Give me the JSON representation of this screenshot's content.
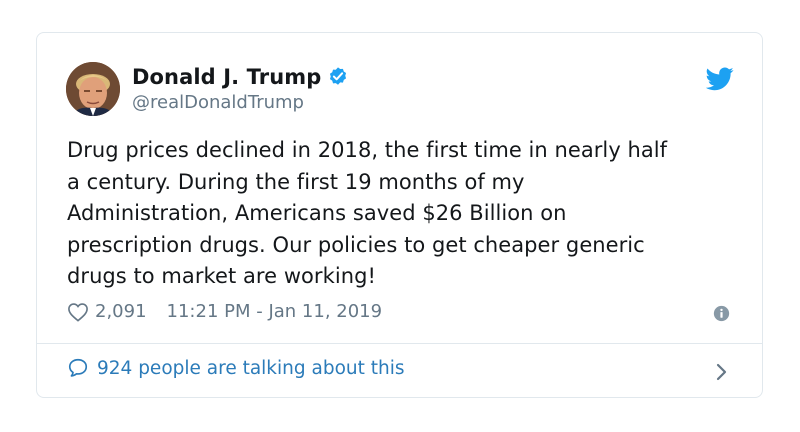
{
  "tweet": {
    "author": {
      "display_name": "Donald J. Trump",
      "handle": "@realDonaldTrump",
      "verified": true
    },
    "text": "Drug prices declined in 2018, the first time in nearly half\na century. During the first 19 months of my\nAdministration, Americans saved $26 Billion on\nprescription drugs. Our policies to get cheaper generic\ndrugs to market are working!",
    "likes": "2,091",
    "timestamp": "11:21 PM - Jan 11, 2019",
    "conversation": "924 people are talking about this"
  },
  "icons": {
    "brand": "twitter-bird-icon",
    "verified": "verified-badge-icon",
    "like": "heart-icon",
    "info": "info-icon",
    "reply": "speech-bubble-icon",
    "more": "chevron-right-icon"
  },
  "colors": {
    "text": "#14171a",
    "secondary": "#657786",
    "link": "#2b7bb9",
    "brand": "#1da1f2",
    "border": "#e1e8ed"
  }
}
